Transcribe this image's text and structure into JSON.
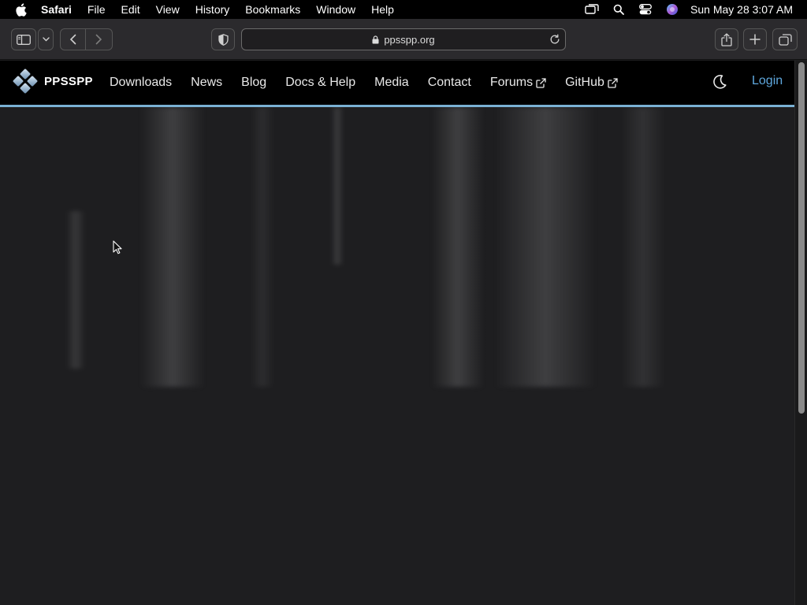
{
  "menubar": {
    "app_name": "Safari",
    "items": [
      "File",
      "Edit",
      "View",
      "History",
      "Bookmarks",
      "Window",
      "Help"
    ],
    "clock": "Sun May 28  3:07 AM"
  },
  "browser": {
    "url": "ppsspp.org"
  },
  "site": {
    "brand": "PPSSPP",
    "nav": {
      "downloads": "Downloads",
      "news": "News",
      "blog": "Blog",
      "docs": "Docs & Help",
      "media": "Media",
      "contact": "Contact",
      "forums": "Forums",
      "github": "GitHub"
    },
    "login": "Login",
    "accent_color": "#7ab1d4",
    "login_color": "#5fa8de"
  },
  "icons": [
    "apple-icon",
    "display-icon",
    "search-icon",
    "control-center-icon",
    "siri-icon",
    "sidebar-icon",
    "chevron-down-icon",
    "back-icon",
    "forward-icon",
    "privacy-shield-icon",
    "lock-icon",
    "reload-icon",
    "share-icon",
    "new-tab-icon",
    "tabs-overview-icon",
    "ppsspp-logo-icon",
    "external-link-icon",
    "moon-icon",
    "mouse-cursor-icon"
  ]
}
